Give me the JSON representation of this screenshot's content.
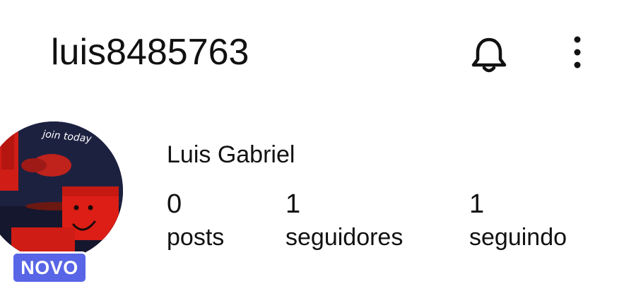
{
  "header": {
    "username": "luis8485763",
    "icons": {
      "notifications": "bell-icon",
      "menu": "more-vertical-icon"
    }
  },
  "profile": {
    "avatar_text": "join today",
    "badge": "NOVO",
    "badge_color": "#5865e6",
    "display_name": "Luis Gabriel",
    "stats": [
      {
        "count": "0",
        "label": "posts"
      },
      {
        "count": "1",
        "label": "seguidores"
      },
      {
        "count": "1",
        "label": "seguindo"
      }
    ]
  }
}
